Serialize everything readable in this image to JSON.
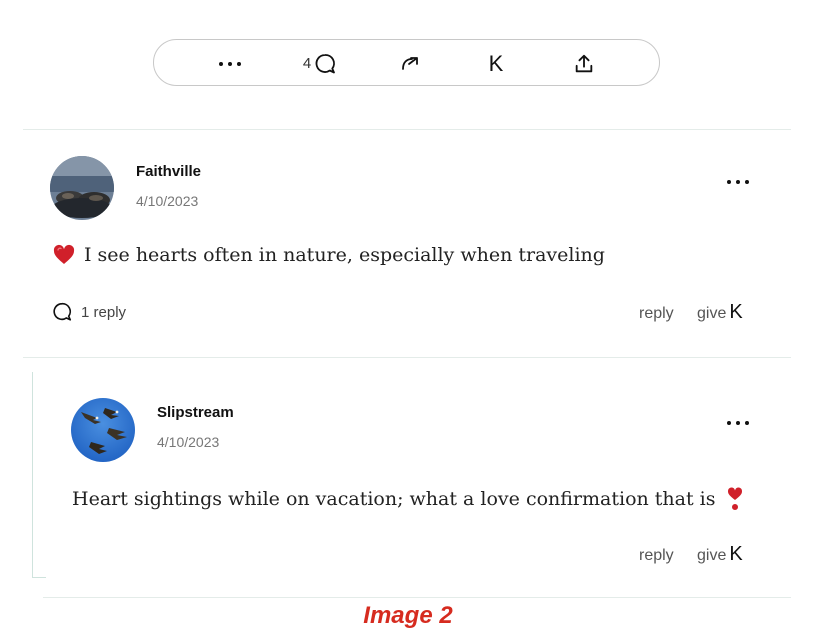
{
  "toolbar": {
    "comment_count": "4",
    "give_label": "K",
    "icons": [
      "more-icon",
      "comment-icon",
      "restack-icon",
      "give-k-icon",
      "share-icon"
    ]
  },
  "comments": [
    {
      "author": "Faithville",
      "date": "4/10/2023",
      "text": "I see hearts often in nature, especially when traveling",
      "reply_count": "1 reply",
      "reply_label": "reply",
      "give_label": "give",
      "give_k": "K"
    },
    {
      "author": "Slipstream",
      "date": "4/10/2023",
      "text": "Heart sightings while on vacation; what a love confirmation that is",
      "reply_label": "reply",
      "give_label": "give",
      "give_k": "K"
    }
  ],
  "caption": "Image 2",
  "colors": {
    "caption": "#d62b1f",
    "divider": "#e4ece9",
    "heart": "#d0202a"
  }
}
